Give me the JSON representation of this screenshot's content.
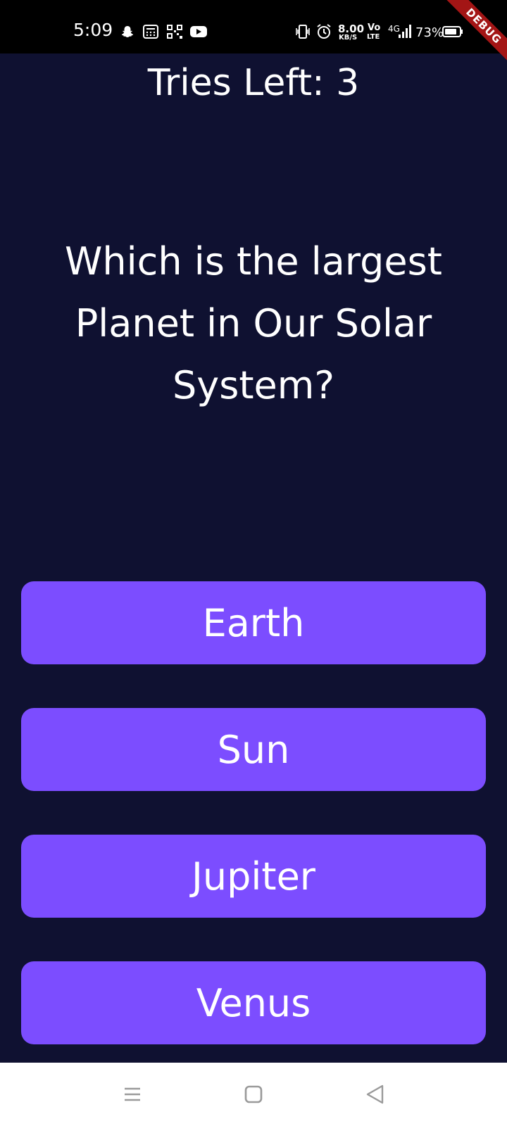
{
  "status_bar": {
    "time": "5:09",
    "net_speed_value": "8.00",
    "net_speed_unit": "KB/S",
    "volte_top": "Vo",
    "volte_bottom": "LTE",
    "network": "4G",
    "battery": "73%",
    "icons": [
      "snapchat-icon",
      "calculator-icon",
      "qr-scan-icon",
      "youtube-icon",
      "vibrate-icon",
      "alarm-icon",
      "signal-icon",
      "battery-icon"
    ]
  },
  "debug_banner": "DEBUG",
  "quiz": {
    "tries_left": "Tries Left: 3",
    "question": "Which is the largest Planet in Our Solar System?",
    "answers": [
      "Earth",
      "Sun",
      "Jupiter",
      "Venus"
    ]
  },
  "colors": {
    "background": "#0f1131",
    "answer_button": "#7c4dff",
    "text": "#ffffff"
  },
  "nav_bar": {
    "icons": [
      "menu-icon",
      "home-icon",
      "back-icon"
    ]
  }
}
